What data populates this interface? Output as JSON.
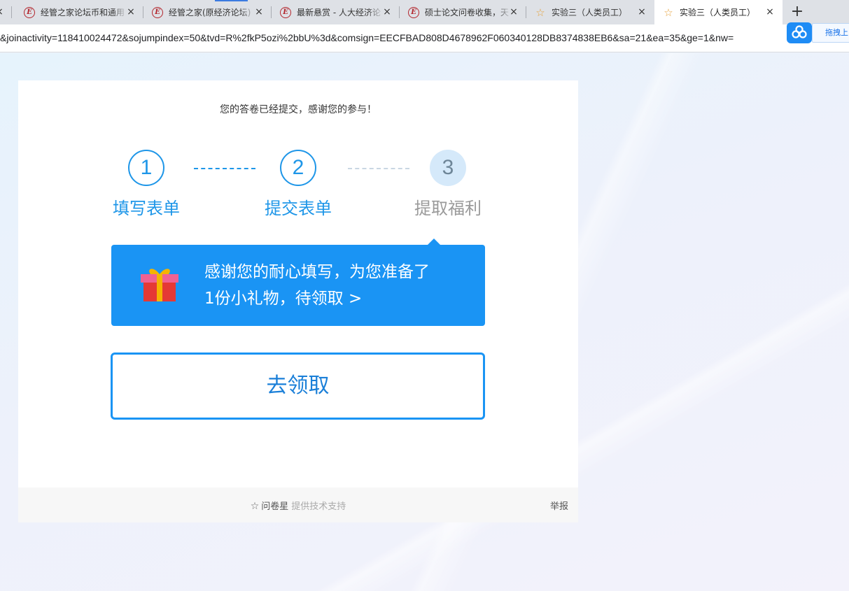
{
  "browser": {
    "tabs": [
      {
        "title": "",
        "favicon": "close-only",
        "active": false
      },
      {
        "title": "经管之家论坛币和通用",
        "favicon": "pinggu-e-icon",
        "active": false
      },
      {
        "title": "经管之家(原经济论坛)",
        "favicon": "pinggu-e-icon",
        "active": false
      },
      {
        "title": "最新悬赏 - 人大经济论",
        "favicon": "pinggu-e-icon",
        "active": false
      },
      {
        "title": "硕士论文问卷收集，天",
        "favicon": "pinggu-e-icon",
        "active": false
      },
      {
        "title": "实验三（人类员工）",
        "favicon": "star-icon",
        "active": false
      },
      {
        "title": "实验三（人类员工）",
        "favicon": "star-icon",
        "active": true
      }
    ],
    "close_glyph": "×",
    "new_tab_glyph": "+",
    "url": "&joinactivity=118410024472&sojumpindex=50&tvd=R%2fkP5ozi%2bbU%3d&comsign=EECFBAD808D4678962F060340128DB8374838EB6&sa=21&ea=35&ge=1&nw=",
    "extension_label": "拖拽上",
    "accent_color": "#1e8cf5"
  },
  "page": {
    "submitted_message": "您的答卷已经提交，感谢您的参与！",
    "steps": [
      {
        "number": "1",
        "label": "填写表单",
        "state": "done"
      },
      {
        "number": "2",
        "label": "提交表单",
        "state": "done"
      },
      {
        "number": "3",
        "label": "提取福利",
        "state": "pending"
      }
    ],
    "gift": {
      "line1": "感谢您的耐心填写，为您准备了",
      "line2": "1份小礼物，待领取 >",
      "icon": "gift-icon",
      "background": "#1a94f4"
    },
    "claim_button": "去领取",
    "footer": {
      "brand": "问卷星",
      "support": "提供技术支持",
      "report": "举报",
      "brand_icon": "star-outline-icon"
    },
    "primary_color": "#1e96e8"
  }
}
